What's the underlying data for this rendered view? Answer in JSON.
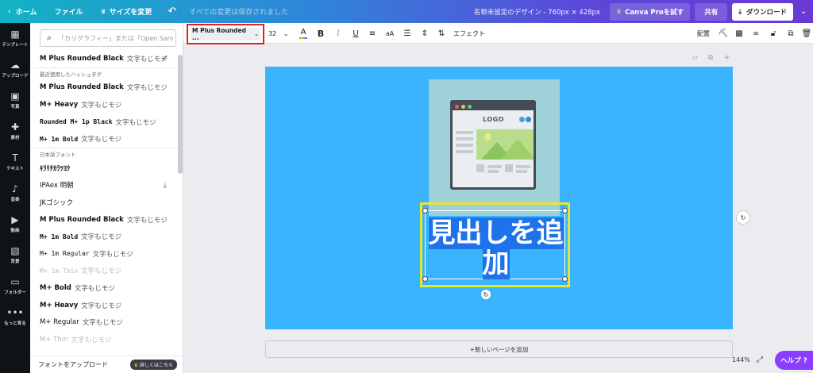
{
  "topbar": {
    "home": "ホーム",
    "file": "ファイル",
    "resize": "サイズを変更",
    "undo_icon": "undo-icon",
    "save_status": "すべての変更は保存されました",
    "doc_title": "名称未設定のデザイン - 760px × 428px",
    "pro_button": "Canva Proを試す",
    "share_button": "共有",
    "download_button": "ダウンロード"
  },
  "rail": [
    {
      "label": "テンプレート",
      "icon": "▦"
    },
    {
      "label": "アップロード",
      "icon": "☁"
    },
    {
      "label": "写真",
      "icon": "▣"
    },
    {
      "label": "素材",
      "icon": "✚"
    },
    {
      "label": "テキスト",
      "icon": "T"
    },
    {
      "label": "音楽",
      "icon": "♪"
    },
    {
      "label": "動画",
      "icon": "▶"
    },
    {
      "label": "背景",
      "icon": "▧"
    },
    {
      "label": "フォルダー",
      "icon": "▭"
    },
    {
      "label": "もっと見る",
      "icon": "•••"
    }
  ],
  "panel": {
    "search_placeholder": "「カリグラフィー」または「Open Sans」",
    "current_font": "M Plus Rounded Black",
    "current_sample": "文字もじモジ",
    "section_recent": "最近使用したハッシュタグ",
    "recent": [
      {
        "name": "M Plus Rounded Black",
        "sample": "文字もじモジ"
      },
      {
        "name": "M+ Heavy",
        "sample": "文字もじモジ"
      },
      {
        "name": "Rounded M+ 1p Black",
        "sample": "文字もじモジ"
      },
      {
        "name": "M+ 1m Bold",
        "sample": "文字もじモジ"
      }
    ],
    "section_japanese": "日本語フォント",
    "japanese": [
      {
        "name": "ｷﾗﾘﾁｶﾗﾂﾖｸ",
        "sample": ""
      },
      {
        "name": "IPAex 明朝",
        "sample": ""
      },
      {
        "name": "JKゴシック",
        "sample": ""
      },
      {
        "name": "M Plus Rounded Black",
        "sample": "文字もじモジ"
      },
      {
        "name": "M+ 1m Bold",
        "sample": "文字もじモジ"
      },
      {
        "name": "M+ 1m Regular",
        "sample": "文字もじモジ"
      },
      {
        "name": "M+ 1m Thin",
        "sample": "文字もじモジ"
      },
      {
        "name": "M+ Bold",
        "sample": "文字もじモジ"
      },
      {
        "name": "M+ Heavy",
        "sample": "文字もじモジ"
      },
      {
        "name": "M+ Regular",
        "sample": "文字もじモジ"
      },
      {
        "name": "M+ Thin",
        "sample": "文字もじモジ"
      }
    ],
    "upgrade_text": "フォントをアップロード",
    "upgrade_badge": "詳しくはこちら"
  },
  "toolbar": {
    "font_name": "M Plus Rounded ...",
    "font_size": "32",
    "effects": "エフェクト",
    "arrange": "配置"
  },
  "canvas": {
    "logo_text": "LOGO",
    "heading_line1": "見出しを追",
    "heading_line2": "加",
    "add_page": "+新しいページを追加",
    "zoom": "144%",
    "help": "ヘルプ ?"
  },
  "colors": {
    "page_bg": "#3ab5fd",
    "selection_highlight": "#e6e62b",
    "font_select_highlight": "#e21e2a",
    "help_button": "#8b3dff"
  }
}
